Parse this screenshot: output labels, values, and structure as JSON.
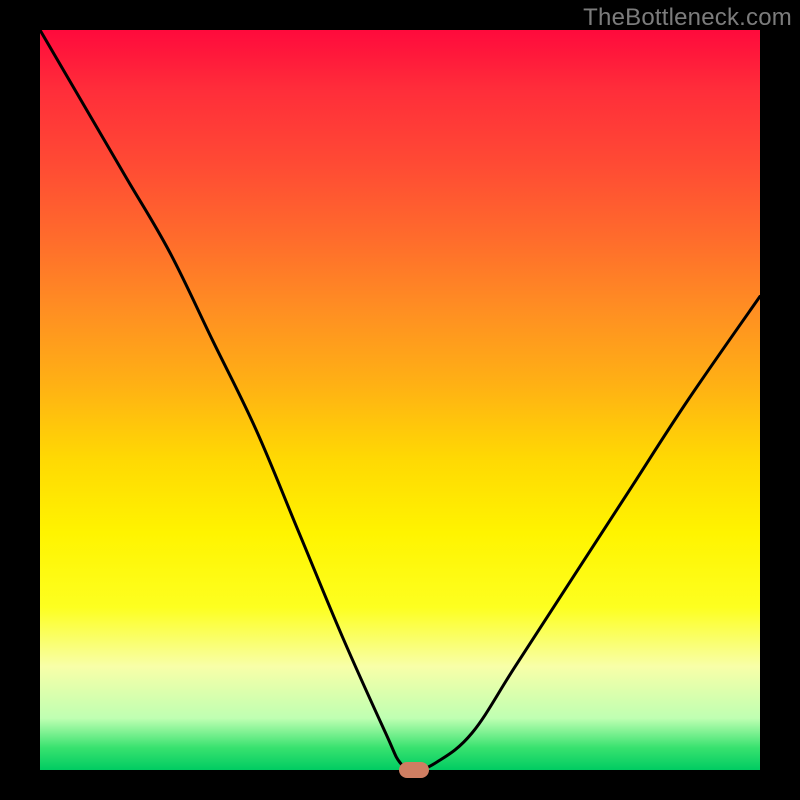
{
  "watermark": "TheBottleneck.com",
  "chart_data": {
    "type": "line",
    "title": "",
    "xlabel": "",
    "ylabel": "",
    "xlim": [
      0,
      100
    ],
    "ylim": [
      0,
      100
    ],
    "grid": false,
    "legend": false,
    "series": [
      {
        "name": "bottleneck-curve",
        "x": [
          0,
          6,
          12,
          18,
          24,
          30,
          36,
          42,
          48,
          50,
          52,
          55,
          60,
          66,
          74,
          82,
          90,
          100
        ],
        "y": [
          100,
          90,
          80,
          70,
          58,
          46,
          32,
          18,
          5,
          1,
          0,
          1,
          5,
          14,
          26,
          38,
          50,
          64
        ]
      }
    ],
    "marker": {
      "x": 52,
      "y": 0,
      "color": "#cf7e62"
    },
    "gradient_stops": [
      {
        "pos": 0.0,
        "color": "#ff0a3c"
      },
      {
        "pos": 0.08,
        "color": "#ff2d3a"
      },
      {
        "pos": 0.18,
        "color": "#ff4a34"
      },
      {
        "pos": 0.28,
        "color": "#ff6b2c"
      },
      {
        "pos": 0.38,
        "color": "#ff8f22"
      },
      {
        "pos": 0.48,
        "color": "#ffb114"
      },
      {
        "pos": 0.58,
        "color": "#ffd903"
      },
      {
        "pos": 0.68,
        "color": "#fff400"
      },
      {
        "pos": 0.78,
        "color": "#fdff20"
      },
      {
        "pos": 0.86,
        "color": "#f8ffa8"
      },
      {
        "pos": 0.93,
        "color": "#bfffb2"
      },
      {
        "pos": 0.97,
        "color": "#38e26f"
      },
      {
        "pos": 1.0,
        "color": "#00cc62"
      }
    ]
  }
}
